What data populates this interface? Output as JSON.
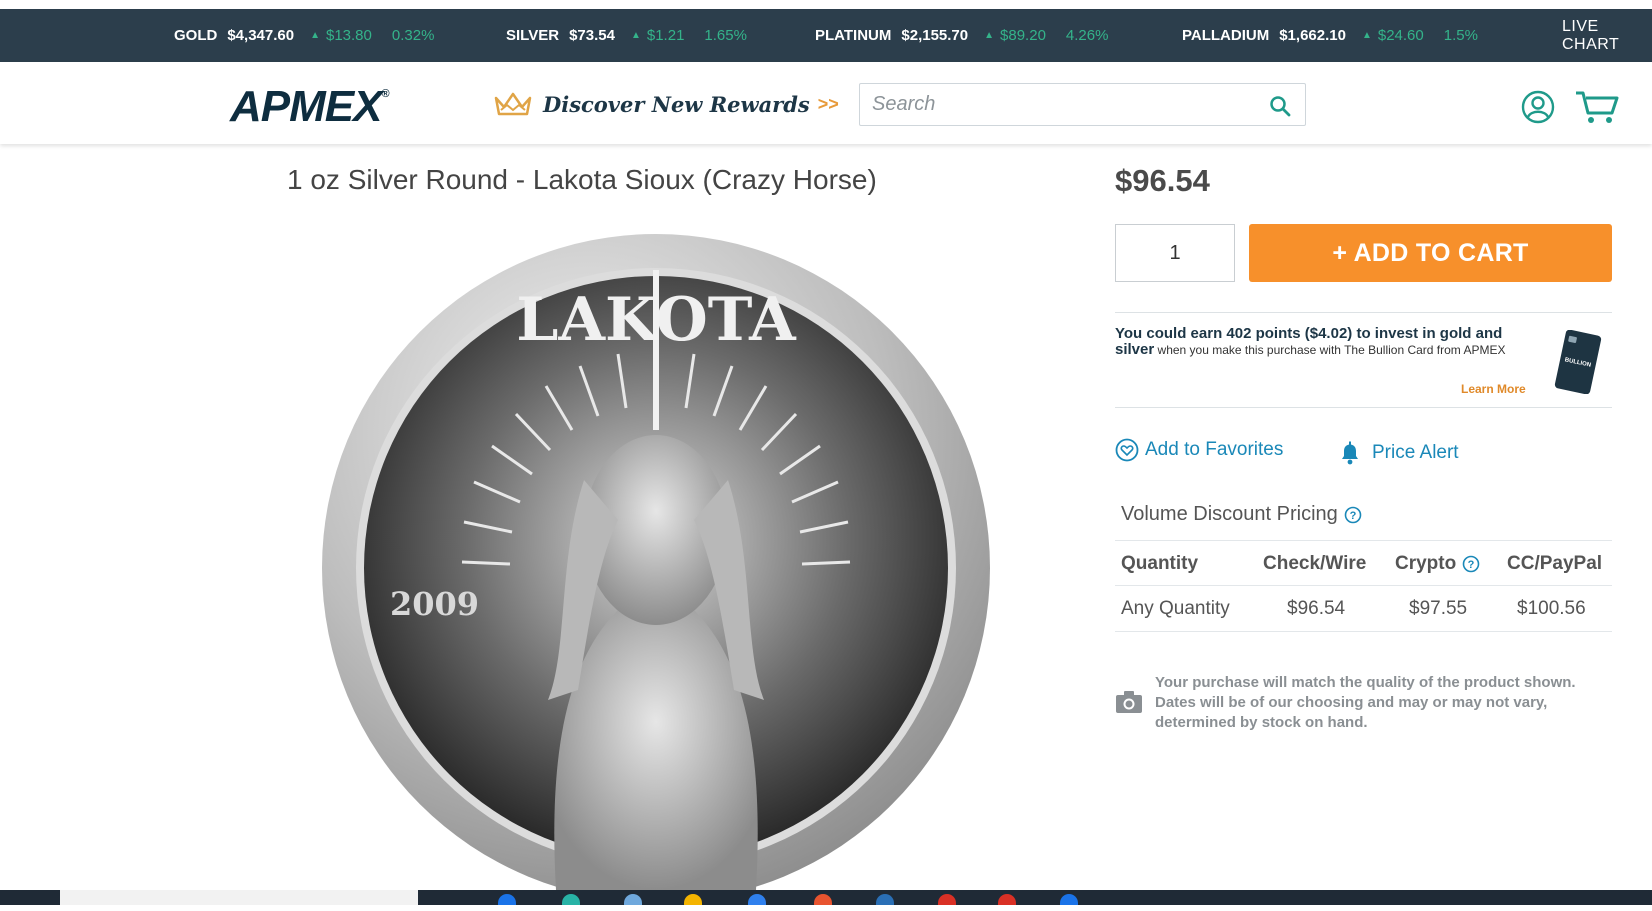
{
  "ticker": {
    "items": [
      {
        "metal": "GOLD",
        "price": "$4,347.60",
        "change": "$13.80",
        "percent": "0.32%"
      },
      {
        "metal": "SILVER",
        "price": "$73.54",
        "change": "$1.21",
        "percent": "1.65%"
      },
      {
        "metal": "PLATINUM",
        "price": "$2,155.70",
        "change": "$89.20",
        "percent": "4.26%"
      },
      {
        "metal": "PALLADIUM",
        "price": "$1,662.10",
        "change": "$24.60",
        "percent": "1.5%"
      }
    ],
    "live_label": "LIVE CHART"
  },
  "header": {
    "logo_text": "APMEX",
    "logo_reg": "®",
    "rewards_label": "Discover New Rewards",
    "rewards_arrows": ">>",
    "search_placeholder": "Search",
    "icons": [
      "search-icon",
      "account-icon",
      "cart-icon"
    ]
  },
  "product": {
    "title": "1 oz Silver Round - Lakota Sioux (Crazy Horse)",
    "price": "$96.54",
    "quantity": "1",
    "add_to_cart": "+  ADD TO CART",
    "coin": {
      "legend": "LAKOTA",
      "year": "2009"
    }
  },
  "rewards_offer": {
    "line_bold": "You could earn 402 points ($4.02) to invest in gold and silver",
    "line_rest": " when you make this purchase with The Bullion Card from APMEX",
    "learn_more": "Learn More",
    "card_text": "BULLION"
  },
  "actions": {
    "favorites": "Add to Favorites",
    "price_alert": "Price Alert"
  },
  "volume_pricing": {
    "title": "Volume Discount Pricing",
    "headers": [
      "Quantity",
      "Check/Wire",
      "Crypto",
      "CC/PayPal"
    ],
    "rows": [
      [
        "Any Quantity",
        "$96.54",
        "$97.55",
        "$100.56"
      ]
    ]
  },
  "disclaimer": "Your purchase will match the quality of the product shown. Dates will be of our choosing and may or may not vary, determined by stock on hand.",
  "colors": {
    "ticker_bg": "#2c3e4c",
    "ticker_up": "#34b38a",
    "accent_orange": "#f7902b",
    "link_blue": "#1a88b8",
    "logo_navy": "#0e2d3f"
  }
}
